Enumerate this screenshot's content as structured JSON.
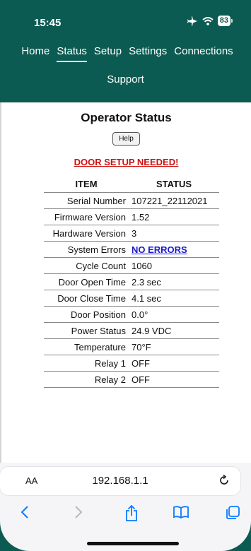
{
  "status_bar": {
    "time": "15:45",
    "battery": "83"
  },
  "nav": {
    "items": [
      "Home",
      "Status",
      "Setup",
      "Settings",
      "Connections"
    ],
    "active": "Status",
    "row2": "Support"
  },
  "page": {
    "title": "Operator Status",
    "help_label": "Help",
    "warning": "DOOR SETUP NEEDED!"
  },
  "table": {
    "headers": {
      "item": "ITEM",
      "status": "STATUS"
    },
    "rows": [
      {
        "label": "Serial Number",
        "value": "107221_22112021"
      },
      {
        "label": "Firmware Version",
        "value": "1.52"
      },
      {
        "label": "Hardware Version",
        "value": "3"
      },
      {
        "label": "System Errors",
        "value": "NO ERRORS"
      },
      {
        "label": "Cycle Count",
        "value": "1060"
      },
      {
        "label": "Door Open Time",
        "value": "2.3 sec"
      },
      {
        "label": "Door Close Time",
        "value": "4.1 sec"
      },
      {
        "label": "Door Position",
        "value": "0.0°"
      },
      {
        "label": "Power Status",
        "value": "24.9 VDC"
      },
      {
        "label": "Temperature",
        "value": "70°F"
      },
      {
        "label": "Relay 1",
        "value": "OFF"
      },
      {
        "label": "Relay 2",
        "value": "OFF"
      }
    ]
  },
  "browser": {
    "text_size": "AA",
    "url": "192.168.1.1"
  },
  "colors": {
    "header_bg": "#0c5b52",
    "warning": "#d01010",
    "link": "#1a1acc",
    "ios_blue": "#0a7aff"
  }
}
